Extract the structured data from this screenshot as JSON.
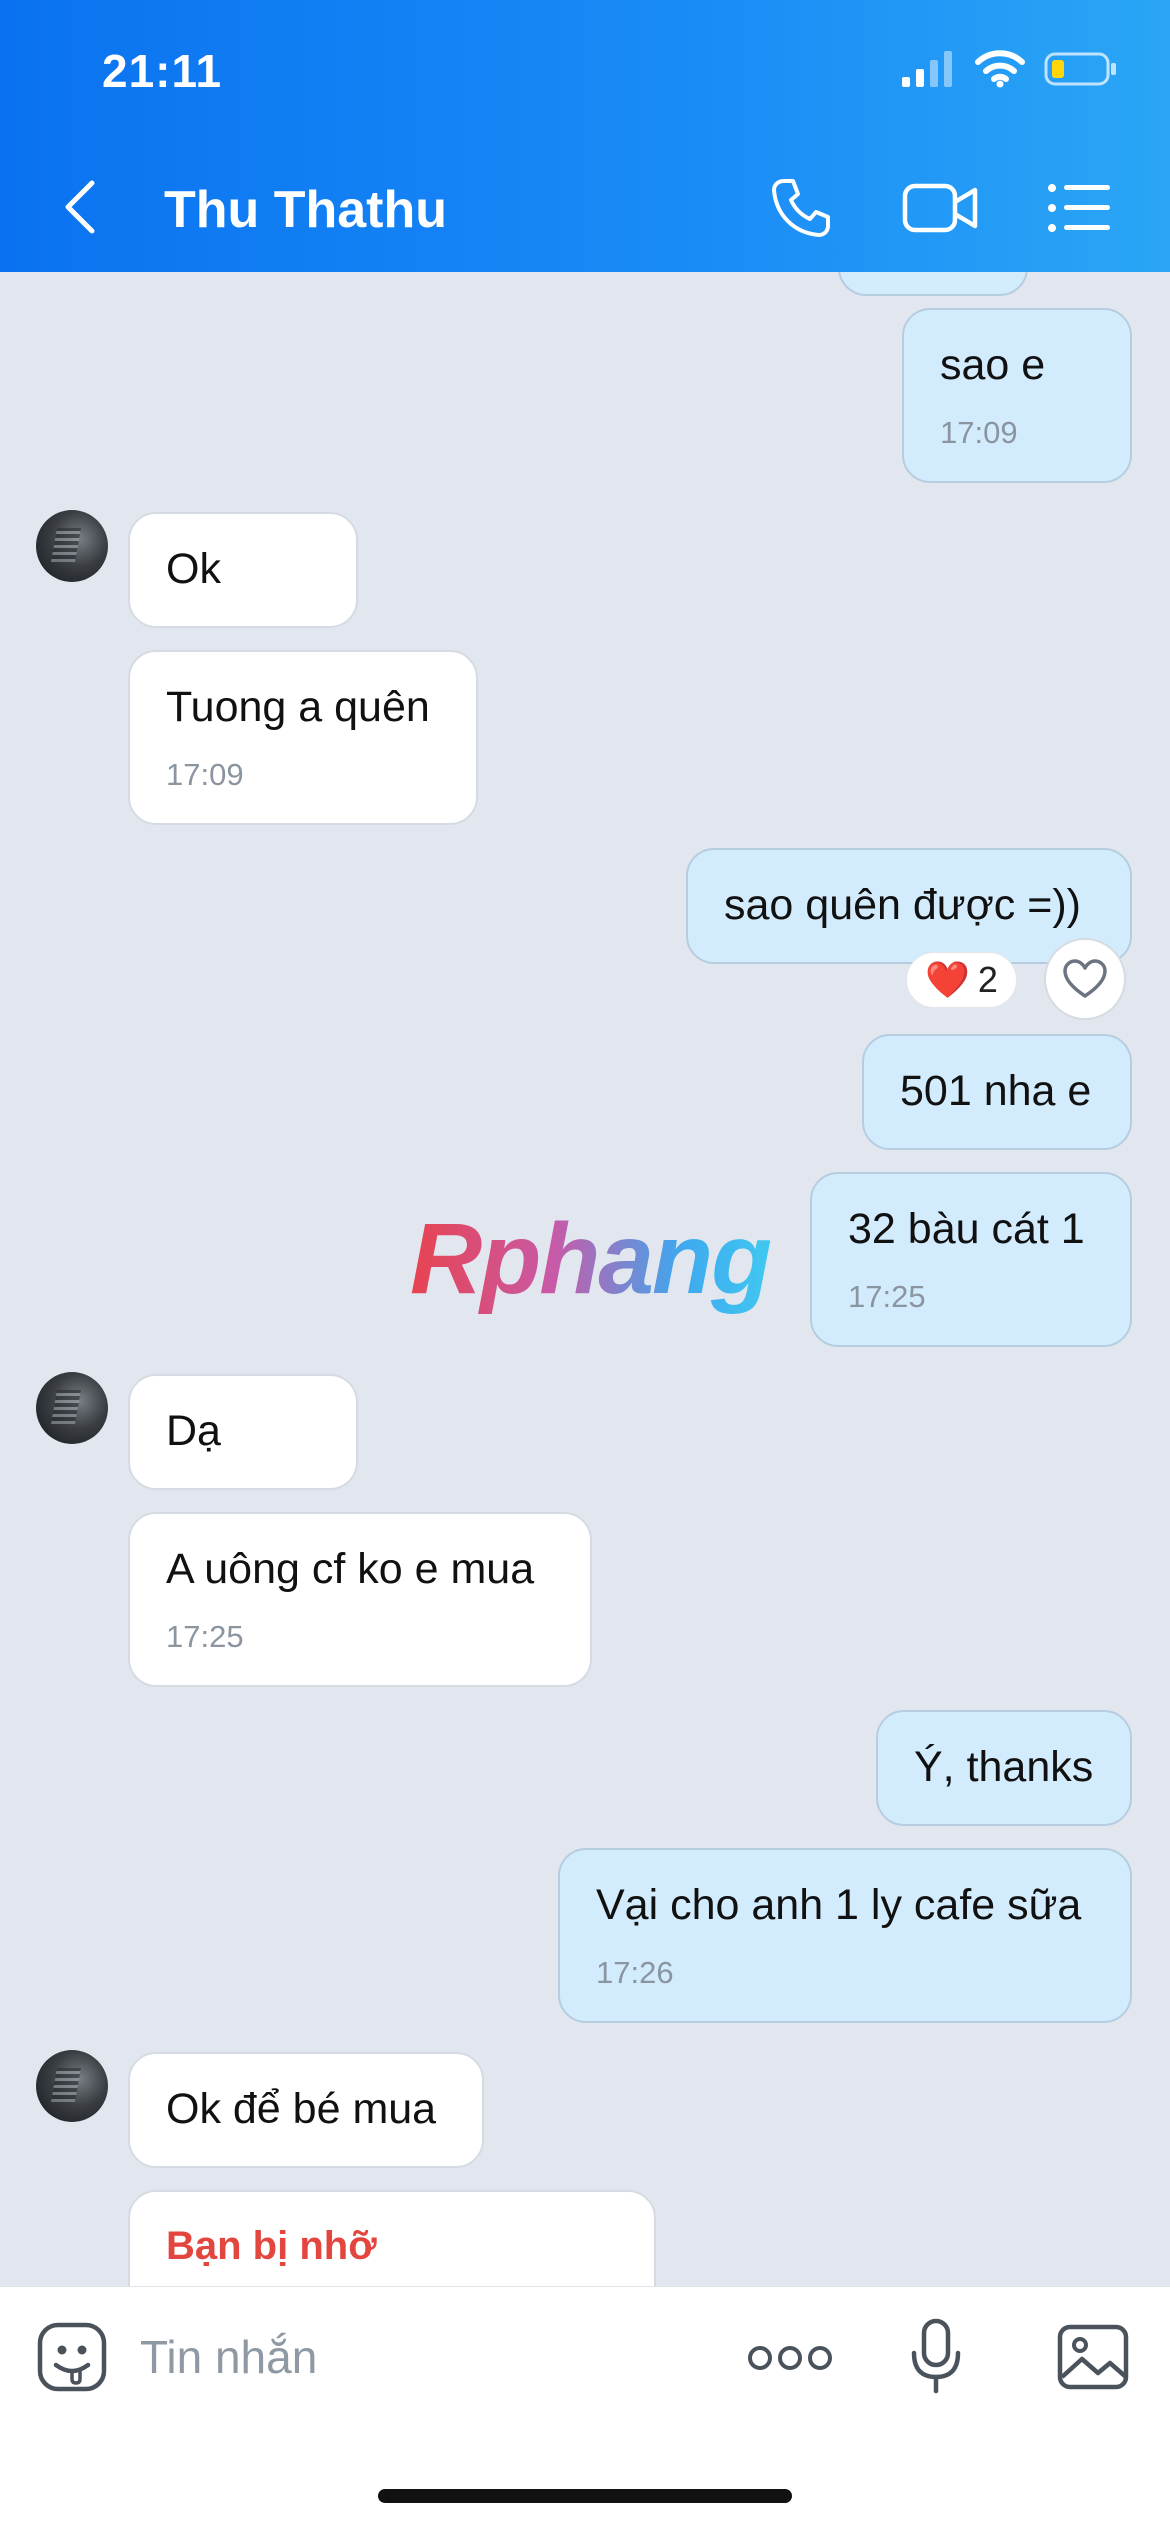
{
  "status_bar": {
    "time": "21:11"
  },
  "header": {
    "contact_name": "Thu Thathu"
  },
  "watermark": "Rphang",
  "messages": [
    {
      "text": "sao e",
      "time": "17:09"
    },
    {
      "text": "Ok"
    },
    {
      "text": "Tuong a quên",
      "time": "17:09"
    },
    {
      "text": "sao quên được =))",
      "reaction": {
        "emoji": "❤️",
        "count": "2"
      }
    },
    {
      "text": "501 nha e"
    },
    {
      "text": "32 bàu cát 1",
      "time": "17:25"
    },
    {
      "text": "Dạ"
    },
    {
      "text": "A uông cf ko e mua",
      "time": "17:25"
    },
    {
      "text": "Ý, thanks"
    },
    {
      "text": "Vại cho anh 1 ly cafe sữa",
      "time": "17:26"
    },
    {
      "text": "Ok để bé mua"
    },
    {
      "text": "Bạn bị nhỡ"
    }
  ],
  "input": {
    "placeholder": "Tin nhắn"
  },
  "colors": {
    "header_start": "#0a72f0",
    "header_end": "#2aa6f5",
    "outgoing_bubble": "#d3ecfd",
    "incoming_bubble": "#ffffff",
    "missed_call": "#e2463f"
  }
}
